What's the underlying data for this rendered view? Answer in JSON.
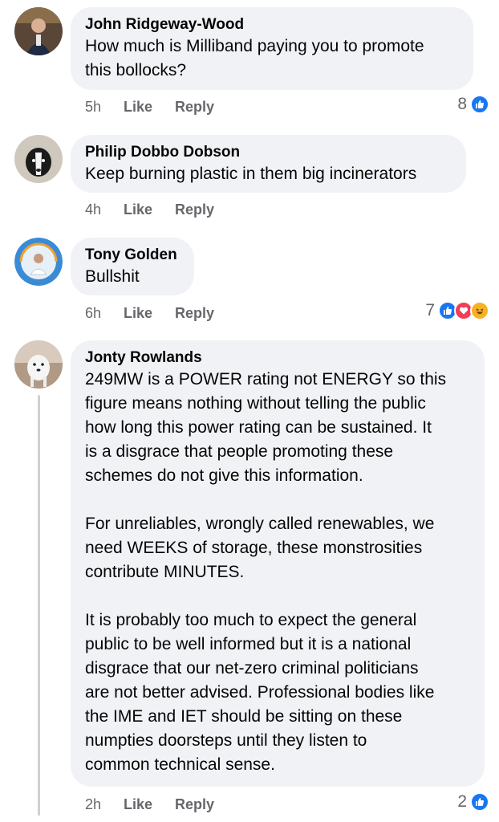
{
  "comments": [
    {
      "author": "John Ridgeway-Wood",
      "text": "How much is Milliband paying you to promote\nthis bollocks?",
      "time": "5h",
      "like_label": "Like",
      "reply_label": "Reply",
      "reaction_count": "8",
      "reactions": [
        "like"
      ]
    },
    {
      "author": "Philip Dobbo Dobson",
      "text": "Keep burning plastic in them big incinerators",
      "time": "4h",
      "like_label": "Like",
      "reply_label": "Reply"
    },
    {
      "author": "Tony Golden",
      "text": "Bullshit",
      "time": "6h",
      "like_label": "Like",
      "reply_label": "Reply",
      "reaction_count": "7",
      "reactions": [
        "like",
        "love",
        "haha"
      ]
    },
    {
      "author": "Jonty Rowlands",
      "text": "249MW is a POWER rating not ENERGY so this\nfigure means nothing without telling the public\nhow long this power rating can be sustained. It\nis a disgrace that people promoting these\nschemes do not give this information.\n\nFor unreliables, wrongly called renewables, we\nneed WEEKS of storage, these monstrosities\ncontribute MINUTES.\n\nIt is probably too much to expect the general\npublic to be well informed but it is a national\ndisgrace that our net-zero criminal politicians\nare not better advised. Professional bodies like\nthe IME and IET should be sitting on these\nnumpties doorsteps until they listen to\ncommon technical sense.",
      "time": "2h",
      "like_label": "Like",
      "reply_label": "Reply",
      "reaction_count": "2",
      "reactions": [
        "like"
      ]
    }
  ],
  "colors": {
    "like_blue": "#1877f2",
    "love_red": "#f33e58",
    "haha_yellow": "#f7b125",
    "bubble_bg": "#f0f2f5",
    "meta_gray": "#65676b"
  }
}
